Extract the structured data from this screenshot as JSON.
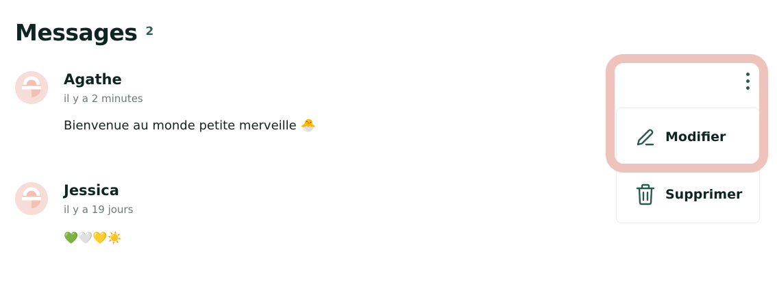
{
  "header": {
    "title": "Messages",
    "count": "2"
  },
  "messages": [
    {
      "author": "Agathe",
      "time": "il y a 2 minutes",
      "text": "Bienvenue au monde petite merveille 🐣"
    },
    {
      "author": "Jessica",
      "time": "il y a 19 jours",
      "text": "💚🤍💛☀️"
    }
  ],
  "menu": {
    "icon": "kebab-icon",
    "items": [
      {
        "label": "Modifier",
        "icon": "pencil-icon"
      },
      {
        "label": "Supprimer",
        "icon": "trash-icon"
      }
    ]
  },
  "colors": {
    "primary_dark": "#0d2621",
    "accent_green": "#2a5a4f",
    "avatar_bg": "#f7ddd7",
    "highlight": "#eec3bc"
  }
}
